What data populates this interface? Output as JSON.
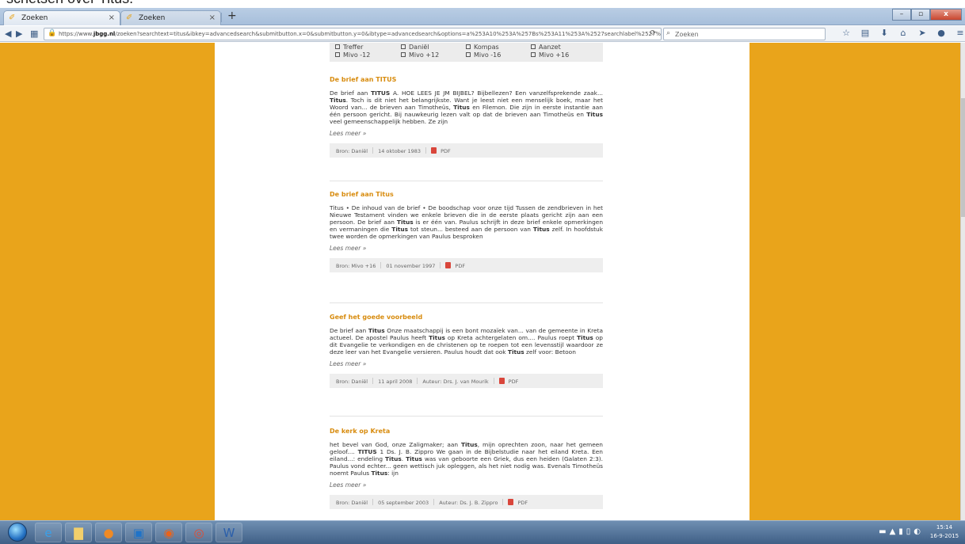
{
  "overlay_text": "schetsen over Titus.",
  "browser": {
    "tabs": [
      {
        "label": "Zoeken",
        "close": "×"
      },
      {
        "label": "Zoeken",
        "close": "×"
      }
    ],
    "new_tab": "+",
    "window_controls": [
      "–",
      "▫",
      "x"
    ],
    "url_prefix": "https://www.",
    "url_domain": "jbgg.nl",
    "url_path": "/zoeken?searchtext=titus&ibkey=advancedsearch&submitbutton.x=0&submitbutton.y=0&ibtype=advancedsearch&options=a%253A10%253A%257Bs%253A11%253A%2527searchlabel%2527%2",
    "search_placeholder": "Zoeken"
  },
  "filters": [
    [
      "Treffer",
      "Mivo -12"
    ],
    [
      "Daniël",
      "Mivo +12"
    ],
    [
      "Kompas",
      "Mivo -16"
    ],
    [
      "Aanzet",
      "Mivo +16"
    ]
  ],
  "results": [
    {
      "title": "De brief aan TITUS",
      "snippet_parts": [
        {
          "t": "De brief aan "
        },
        {
          "t": "TITUS",
          "b": true
        },
        {
          "t": " A. HOE LEES JE JM BIJBEL? Bijbellezen? Een vanzelfsprekende zaak... "
        },
        {
          "t": "Titus",
          "b": true
        },
        {
          "t": ". Toch is dit niet het belangrijkste. Want je leest niet een menselijk boek, maar het Woord van... de brieven aan Timotheüs, "
        },
        {
          "t": "Titus",
          "b": true
        },
        {
          "t": " en Filemon. Die zijn in eerste instantie aan één persoon gericht. Bij nauwkeurig lezen valt op dat de brieven aan Timotheüs en "
        },
        {
          "t": "Titus",
          "b": true
        },
        {
          "t": " veel gemeenschappelijk hebben. Ze zijn"
        }
      ],
      "more": "Lees meer »",
      "source": "Bron: Daniël",
      "date": "14 oktober 1983",
      "author": "",
      "pdf": "PDF"
    },
    {
      "title": "De brief aan Titus",
      "snippet_parts": [
        {
          "t": "Titus • De inhoud van de brief • De boodschap voor onze tijd Tussen de zendbrieven in het Nieuwe Testament vinden we enkele brieven die in de eerste plaats gericht zijn aan een persoon. De brief aan "
        },
        {
          "t": "Titus",
          "b": true
        },
        {
          "t": " is er één van. Paulus schrijft in deze brief enkele opmerkingen en vermaningen die "
        },
        {
          "t": "Titus",
          "b": true
        },
        {
          "t": " tot steun... besteed aan de persoon van "
        },
        {
          "t": "Titus",
          "b": true
        },
        {
          "t": " zelf. In hoofdstuk twee worden de opmerkingen van Paulus besproken"
        }
      ],
      "more": "Lees meer »",
      "source": "Bron: Mivo +16",
      "date": "01 november 1997",
      "author": "",
      "pdf": "PDF"
    },
    {
      "title": "Geef het goede voorbeeld",
      "snippet_parts": [
        {
          "t": "De brief aan "
        },
        {
          "t": "Titus",
          "b": true
        },
        {
          "t": " Onze maatschappij is een bont mozaïek van... van de gemeente in Kreta actueel. De apostel Paulus heeft "
        },
        {
          "t": "Titus",
          "b": true
        },
        {
          "t": " op Kreta achtergelaten om.... Paulus roept "
        },
        {
          "t": "Titus",
          "b": true
        },
        {
          "t": " op dit Evangelie te verkondigen en de christenen op te roepen tot een levensstijl waardoor ze deze leer van het Evangelie versieren. Paulus houdt dat ook "
        },
        {
          "t": "Titus",
          "b": true
        },
        {
          "t": " zelf voor: Betoon"
        }
      ],
      "more": "Lees meer »",
      "source": "Bron: Daniël",
      "date": "11 april 2008",
      "author": "Auteur: Drs. J. van Mourik",
      "pdf": "PDF"
    },
    {
      "title": "De kerk op Kreta",
      "snippet_parts": [
        {
          "t": "het bevel van God, onze Zaligmaker; aan "
        },
        {
          "t": "Titus",
          "b": true
        },
        {
          "t": ", mijn oprechten zoon, naar het gemeen geloof.... "
        },
        {
          "t": "TITUS",
          "b": true
        },
        {
          "t": " 1 Ds. J. B. Zippro We gaan in de Bijbelstudie naar het eiland Kreta. Een eiland...: endeling "
        },
        {
          "t": "Titus",
          "b": true
        },
        {
          "t": ". "
        },
        {
          "t": "Titus",
          "b": true
        },
        {
          "t": " was van geboorte een Griek, dus een heiden (Galaten 2:3). Paulus vond echter... geen wettisch juk opleggen, als het niet nodig was. Evenals Timotheüs noemt Paulus "
        },
        {
          "t": "Titus",
          "b": true
        },
        {
          "t": ": ijn"
        }
      ],
      "more": "Lees meer »",
      "source": "Bron: Daniël",
      "date": "05 september 2003",
      "author": "Auteur: Ds. J. B. Zippro",
      "pdf": "PDF"
    }
  ],
  "clock": {
    "time": "15:14",
    "date": "16-9-2015"
  },
  "colors": {
    "accent": "#d88c0f",
    "page_bg": "#e9a41b"
  }
}
